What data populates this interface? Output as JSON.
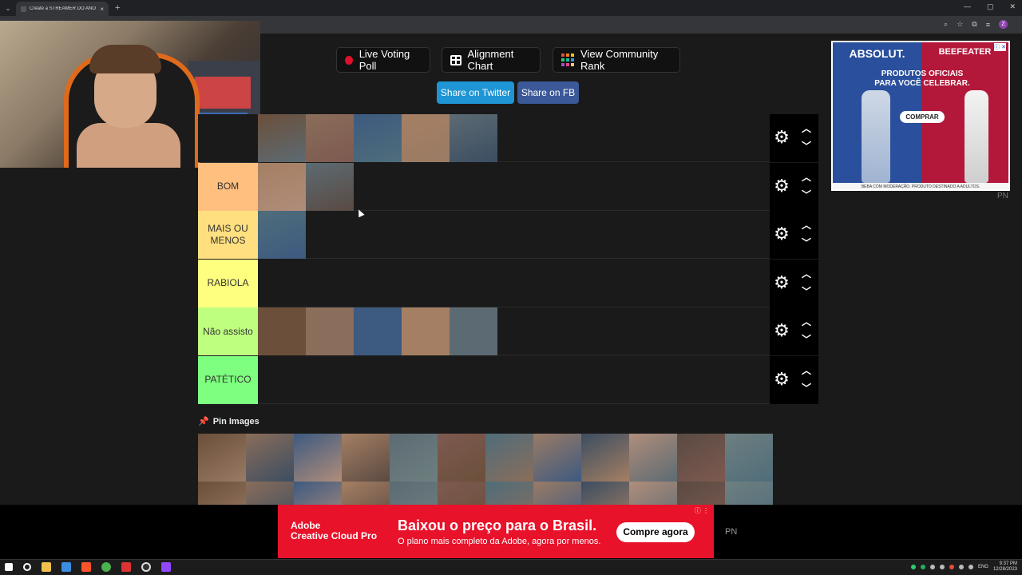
{
  "browser": {
    "tab_title": "Create a STREAMER DO ANO (20...",
    "tab_close": "×",
    "new_tab": "+",
    "menu": "⌄",
    "window_controls": [
      "—",
      "▢",
      "✕"
    ],
    "toolbar_icons": [
      "⌕",
      "☆",
      "⧉",
      "≡"
    ],
    "profile_initial": "Z"
  },
  "actions": {
    "live_poll": "Live Voting Poll",
    "alignment": "Alignment Chart",
    "community": "View Community Rank",
    "share_twitter": "Share on Twitter",
    "share_fb": "Share on FB"
  },
  "colors": {
    "twitter": "#1e95d4",
    "facebook": "#3b5998",
    "bom": "#ffbf7f",
    "mais_ou_menos": "#ffdf7f",
    "rabiola": "#ffff7f",
    "nao_assisto": "#bfff7f",
    "patetico": "#7fff7f"
  },
  "tiers": [
    {
      "label": "",
      "color": "#1a1a1a",
      "count": 5
    },
    {
      "label": "BOM",
      "color": "#ffbf7f",
      "count": 2
    },
    {
      "label": "MAIS OU MENOS",
      "color": "#ffdf7f",
      "count": 1
    },
    {
      "label": "RABIOLA",
      "color": "#ffff7f",
      "count": 0
    },
    {
      "label": "Não assisto",
      "color": "#bfff7f",
      "count": 5
    },
    {
      "label": "PATÉTICO",
      "color": "#7fff7f",
      "count": 0
    }
  ],
  "tier_controls": {
    "gear": "⚙",
    "up": "︿",
    "down": "﹀"
  },
  "pin": {
    "icon": "📌",
    "title": "Pin Images",
    "count": 24
  },
  "ads": {
    "right": {
      "brand_left": "ABSOLUT.",
      "brand_right": "BEEFEATER",
      "tagline": "PRODUTOS OFICIAIS PARA VOCÊ CELEBRAR.",
      "cta": "COMPRAR",
      "footer": "BEBA COM MODERAÇÃO. PRODUTO DESTINADO A ADULTOS.",
      "info": "ⓘ ✕",
      "pn": "PN"
    },
    "bottom": {
      "logo_line1": "Adobe",
      "logo_line2": "Creative Cloud Pro",
      "headline": "Baixou o preço para o Brasil.",
      "subline": "O plano mais completo da Adobe, agora por menos.",
      "cta": "Compre agora",
      "info": "ⓘ ⋮",
      "pn": "PN"
    }
  },
  "taskbar": {
    "lang": "ENG",
    "time": "9:37 PM",
    "date": "12/28/2023"
  }
}
